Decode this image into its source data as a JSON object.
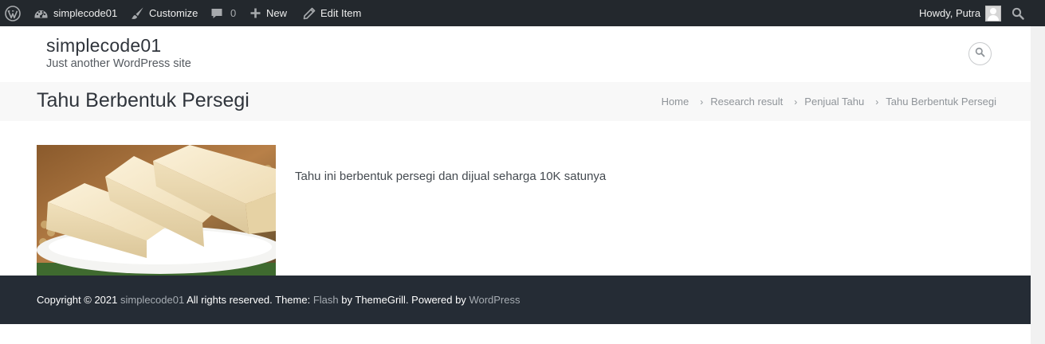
{
  "adminbar": {
    "site_name": "simplecode01",
    "customize": "Customize",
    "comments_count": "0",
    "new": "New",
    "edit_item": "Edit Item",
    "greeting": "Howdy, Putra"
  },
  "header": {
    "site_title": "simplecode01",
    "tagline": "Just another WordPress site"
  },
  "page": {
    "title": "Tahu Berbentuk Persegi",
    "breadcrumb": [
      "Home",
      "Research result",
      "Penjual Tahu",
      "Tahu Berbentuk Persegi"
    ]
  },
  "content": {
    "description": "Tahu ini berbentuk persegi dan dijual seharga 10K satunya"
  },
  "footer": {
    "copyright_prefix": "Copyright © 2021",
    "site_link": "simplecode01",
    "rights_theme": "All rights reserved. Theme:",
    "theme_link": "Flash",
    "by_text": "by ThemeGrill. Powered by",
    "wp_link": "WordPress"
  },
  "colors": {
    "adminbar_bg": "#23282d",
    "footer_bg": "#252c35",
    "page_band_bg": "#f8f8f8",
    "link_muted": "#a6acb2"
  },
  "icons": {
    "wp_logo": "wordpress-logo-icon",
    "site": "dashboard-icon",
    "customize": "paintbrush-icon",
    "comments": "comment-bubble-icon",
    "new": "plus-icon",
    "edit": "pencil-icon",
    "search": "search-icon"
  }
}
